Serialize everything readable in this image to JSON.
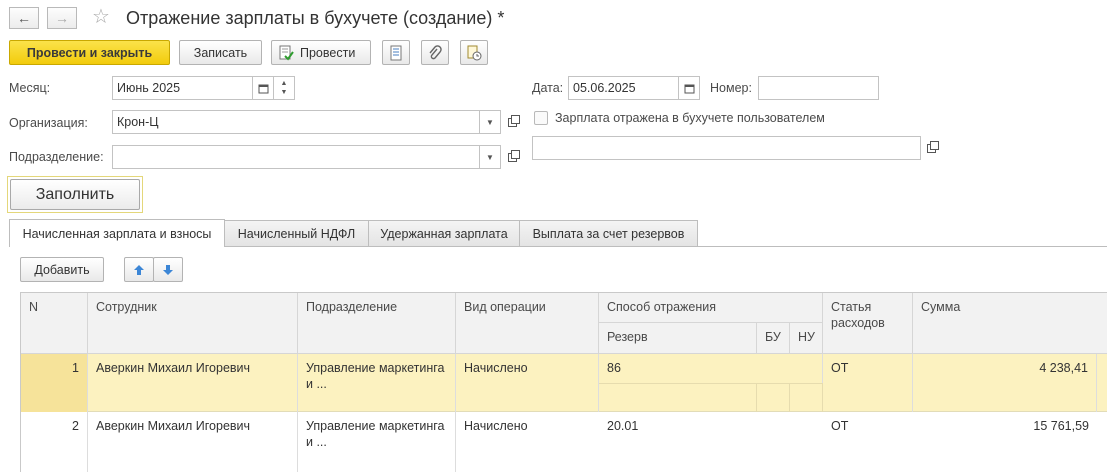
{
  "header": {
    "title": "Отражение зарплаты в бухучете (создание) *"
  },
  "toolbar": {
    "post_close": "Провести и закрыть",
    "save": "Записать",
    "post": "Провести"
  },
  "form": {
    "month_label": "Месяц:",
    "month_value": "Июнь 2025",
    "date_label": "Дата:",
    "date_value": "05.06.2025",
    "number_label": "Номер:",
    "number_value": "",
    "org_label": "Организация:",
    "org_value": "Крон-Ц",
    "checkbox_label": "Зарплата отражена в бухучете пользователем",
    "dept_label": "Подразделение:",
    "dept_value": "",
    "comment_value": "",
    "fill_button": "Заполнить"
  },
  "tabs": [
    {
      "label": "Начисленная зарплата и взносы",
      "active": true
    },
    {
      "label": "Начисленный НДФЛ",
      "active": false
    },
    {
      "label": "Удержанная зарплата",
      "active": false
    },
    {
      "label": "Выплата за счет резервов",
      "active": false
    }
  ],
  "table_toolbar": {
    "add": "Добавить"
  },
  "table": {
    "headers": {
      "n": "N",
      "employee": "Сотрудник",
      "department": "Подразделение",
      "operation": "Вид операции",
      "method": "Способ отражения",
      "reserve": "Резерв",
      "bu": "БУ",
      "nu": "НУ",
      "expense": "Статья расходов",
      "sum": "Сумма"
    },
    "rows": [
      {
        "n": "1",
        "employee": "Аверкин Михаил Игоревич",
        "department": "Управление маркетинга и ...",
        "operation": "Начислено",
        "method": "86",
        "expense": "ОТ",
        "sum": "4 238,41"
      },
      {
        "n": "2",
        "employee": "Аверкин Михаил Игоревич",
        "department": "Управление маркетинга и ...",
        "operation": "Начислено",
        "method": "20.01",
        "expense": "ОТ",
        "sum": "15 761,59"
      }
    ]
  },
  "colors": {
    "primary_button": "#f5d000",
    "selected_row": "#fcf2c0"
  }
}
